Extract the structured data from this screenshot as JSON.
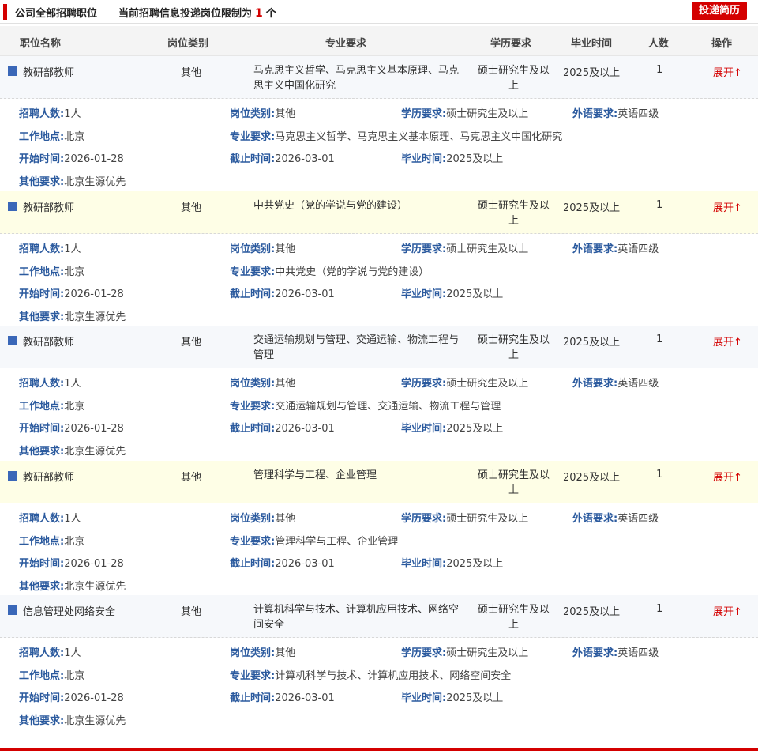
{
  "header": {
    "title": "公司全部招聘职位",
    "notice_prefix": "当前招聘信息投递岗位限制为",
    "limit": "1",
    "notice_suffix": "个",
    "apply_button": "投递简历"
  },
  "columns": [
    "职位名称",
    "岗位类别",
    "专业要求",
    "学历要求",
    "毕业时间",
    "人数",
    "操作"
  ],
  "detail_labels": {
    "recruit_count": "招聘人数:",
    "category": "岗位类别:",
    "education": "学历要求:",
    "language": "外语要求:",
    "location": "工作地点:",
    "major": "专业要求:",
    "start": "开始时间:",
    "end": "截止时间:",
    "grad": "毕业时间:",
    "other": "其他要求:"
  },
  "jobs": [
    {
      "name": "教研部教师",
      "category": "其他",
      "major": "马克思主义哲学、马克思主义基本原理、马克思主义中国化研究",
      "education": "硕士研究生及以上",
      "grad": "2025及以上",
      "count": "1",
      "action": "展开↑",
      "recruit_count": "1人",
      "language": "英语四级",
      "location": "北京",
      "start": "2026-01-28",
      "end": "2026-03-01",
      "other": "北京生源优先"
    },
    {
      "name": "教研部教师",
      "category": "其他",
      "major": "中共党史（党的学说与党的建设）",
      "education": "硕士研究生及以上",
      "grad": "2025及以上",
      "count": "1",
      "action": "展开↑",
      "recruit_count": "1人",
      "language": "英语四级",
      "location": "北京",
      "start": "2026-01-28",
      "end": "2026-03-01",
      "other": "北京生源优先"
    },
    {
      "name": "教研部教师",
      "category": "其他",
      "major": "交通运输规划与管理、交通运输、物流工程与管理",
      "education": "硕士研究生及以上",
      "grad": "2025及以上",
      "count": "1",
      "action": "展开↑",
      "recruit_count": "1人",
      "language": "英语四级",
      "location": "北京",
      "start": "2026-01-28",
      "end": "2026-03-01",
      "other": "北京生源优先"
    },
    {
      "name": "教研部教师",
      "category": "其他",
      "major": "管理科学与工程、企业管理",
      "education": "硕士研究生及以上",
      "grad": "2025及以上",
      "count": "1",
      "action": "展开↑",
      "recruit_count": "1人",
      "language": "英语四级",
      "location": "北京",
      "start": "2026-01-28",
      "end": "2026-03-01",
      "other": "北京生源优先"
    },
    {
      "name": "信息管理处网络安全",
      "category": "其他",
      "major": "计算机科学与技术、计算机应用技术、网络空间安全",
      "education": "硕士研究生及以上",
      "grad": "2025及以上",
      "count": "1",
      "action": "展开↑",
      "recruit_count": "1人",
      "language": "英语四级",
      "location": "北京",
      "start": "2026-01-28",
      "end": "2026-03-01",
      "other": "北京生源优先"
    }
  ],
  "colors": {
    "accent": "#d40000",
    "label_blue": "#2b5a9e",
    "row_light": "#f6f8fb",
    "row_yellow": "#fefee6"
  }
}
